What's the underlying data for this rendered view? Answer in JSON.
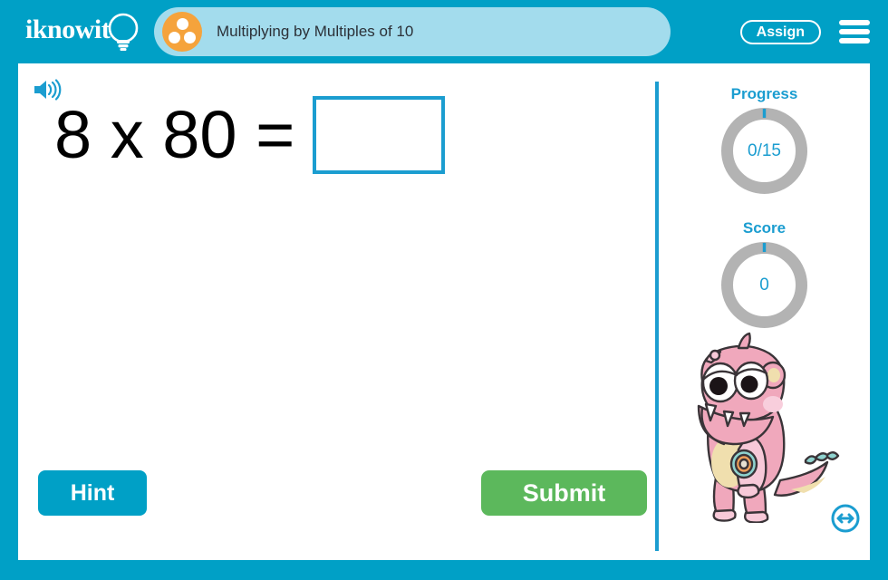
{
  "header": {
    "logo_text": "iknowit",
    "logo_icon": "lightbulb-icon",
    "badge_icon": "three-dots-circle-icon",
    "lesson_title": "Multiplying by Multiples of 10",
    "assign_label": "Assign",
    "menu_icon": "hamburger-menu-icon"
  },
  "question": {
    "audio_icon": "speaker-icon",
    "prompt": "8 x 80 =",
    "answer_value": "",
    "answer_placeholder": ""
  },
  "actions": {
    "hint_label": "Hint",
    "submit_label": "Submit"
  },
  "sidebar": {
    "progress": {
      "label": "Progress",
      "value_text": "0/15",
      "completed": 0,
      "total": 15,
      "percent": 0
    },
    "score": {
      "label": "Score",
      "value_text": "0",
      "value": 0,
      "percent": 0
    },
    "mascot_icon": "pink-monster-mascot",
    "resize_icon": "left-right-arrow-circle-icon"
  },
  "colors": {
    "brand_blue": "#00a0c6",
    "accent_blue": "#1b9dd0",
    "title_panel": "#a3dced",
    "badge_orange": "#f5a33c",
    "submit_green": "#5cb85c",
    "ring_gray": "#b3b3b3",
    "mascot_pink": "#f0a8bc"
  }
}
